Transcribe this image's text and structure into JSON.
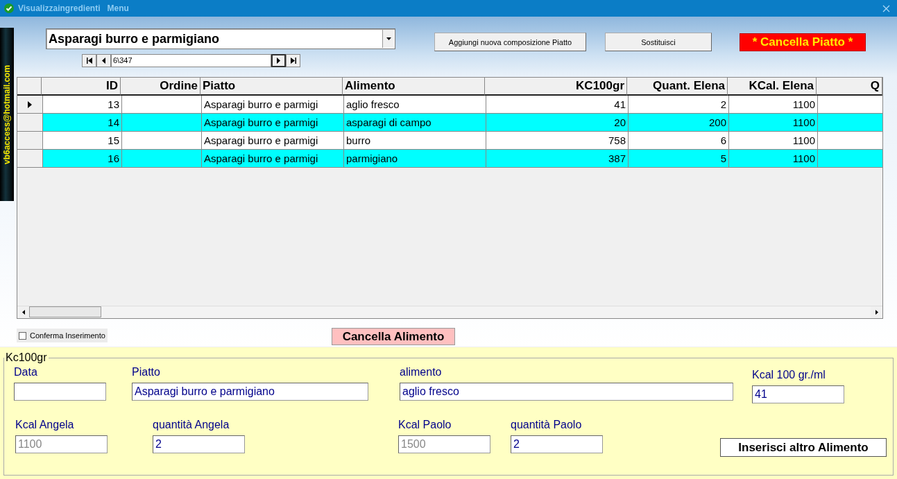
{
  "window": {
    "title": "Visualizzaingredienti",
    "menu": "Menu"
  },
  "sidebar_label": "vb6access@hotmail.com",
  "dish_selector": {
    "value": "Asparagi burro e parmigiano"
  },
  "record_navigator": {
    "position": "6\\347"
  },
  "buttons": [
    {
      "label": "Aggiungi nuova composizione Piatto",
      "kind": "plain"
    },
    {
      "label": "Sostituisci",
      "kind": "plain"
    },
    {
      "label": "* Cancella Piatto *",
      "kind": "danger"
    }
  ],
  "table": {
    "columns": [
      {
        "label": "ID",
        "kind": "number"
      },
      {
        "label": "Ordine",
        "kind": "number"
      },
      {
        "label": "Piatto",
        "kind": "text"
      },
      {
        "label": "Alimento",
        "kind": "text"
      },
      {
        "label": "KC100gr",
        "kind": "number"
      },
      {
        "label": "Quant. Elena",
        "kind": "number"
      },
      {
        "label": "KCal. Elena",
        "kind": "number"
      },
      {
        "label": "Q",
        "kind": "number"
      }
    ],
    "rows": [
      {
        "current": true,
        "highlighted": false,
        "cells": [
          "13",
          null,
          "Asparagi burro e parmigi",
          "aglio fresco",
          "41",
          "2",
          "1100",
          null
        ]
      },
      {
        "current": false,
        "highlighted": true,
        "cells": [
          "14",
          null,
          "Asparagi burro e parmigi",
          "asparagi di campo",
          "20",
          "200",
          "1100",
          null
        ]
      },
      {
        "current": false,
        "highlighted": false,
        "cells": [
          "15",
          null,
          "Asparagi burro e parmigi",
          "burro",
          "758",
          "6",
          "1100",
          null
        ]
      },
      {
        "current": false,
        "highlighted": true,
        "cells": [
          "16",
          null,
          "Asparagi burro e parmigi",
          "parmigiano",
          "387",
          "5",
          "1100",
          null
        ]
      }
    ]
  },
  "confirm_checkbox": {
    "label": "Conferma Inserimento",
    "checked": false
  },
  "delete_food_button": "Cancella Alimento",
  "detail": {
    "legend": "Kc100gr",
    "rows": [
      [
        {
          "label": "Data"
        },
        {
          "label": "Piatto",
          "value": "Asparagi burro e parmigiano",
          "disabled": false
        },
        {
          "label": "alimento",
          "value": "aglio fresco",
          "disabled": false
        },
        {
          "label": "Kcal 100 gr./ml",
          "value": "41",
          "disabled": false
        }
      ],
      [
        {
          "label": "Kcal Angela",
          "value": "1100",
          "disabled": true
        },
        {
          "label": "quantità Angela",
          "value": "2",
          "disabled": false
        },
        {
          "label": "Kcal Paolo",
          "value": "1500",
          "disabled": true
        },
        {
          "label": "quantità Paolo",
          "value": "2",
          "disabled": false
        }
      ]
    ],
    "insert_button": "Inserisci altro Alimento"
  }
}
